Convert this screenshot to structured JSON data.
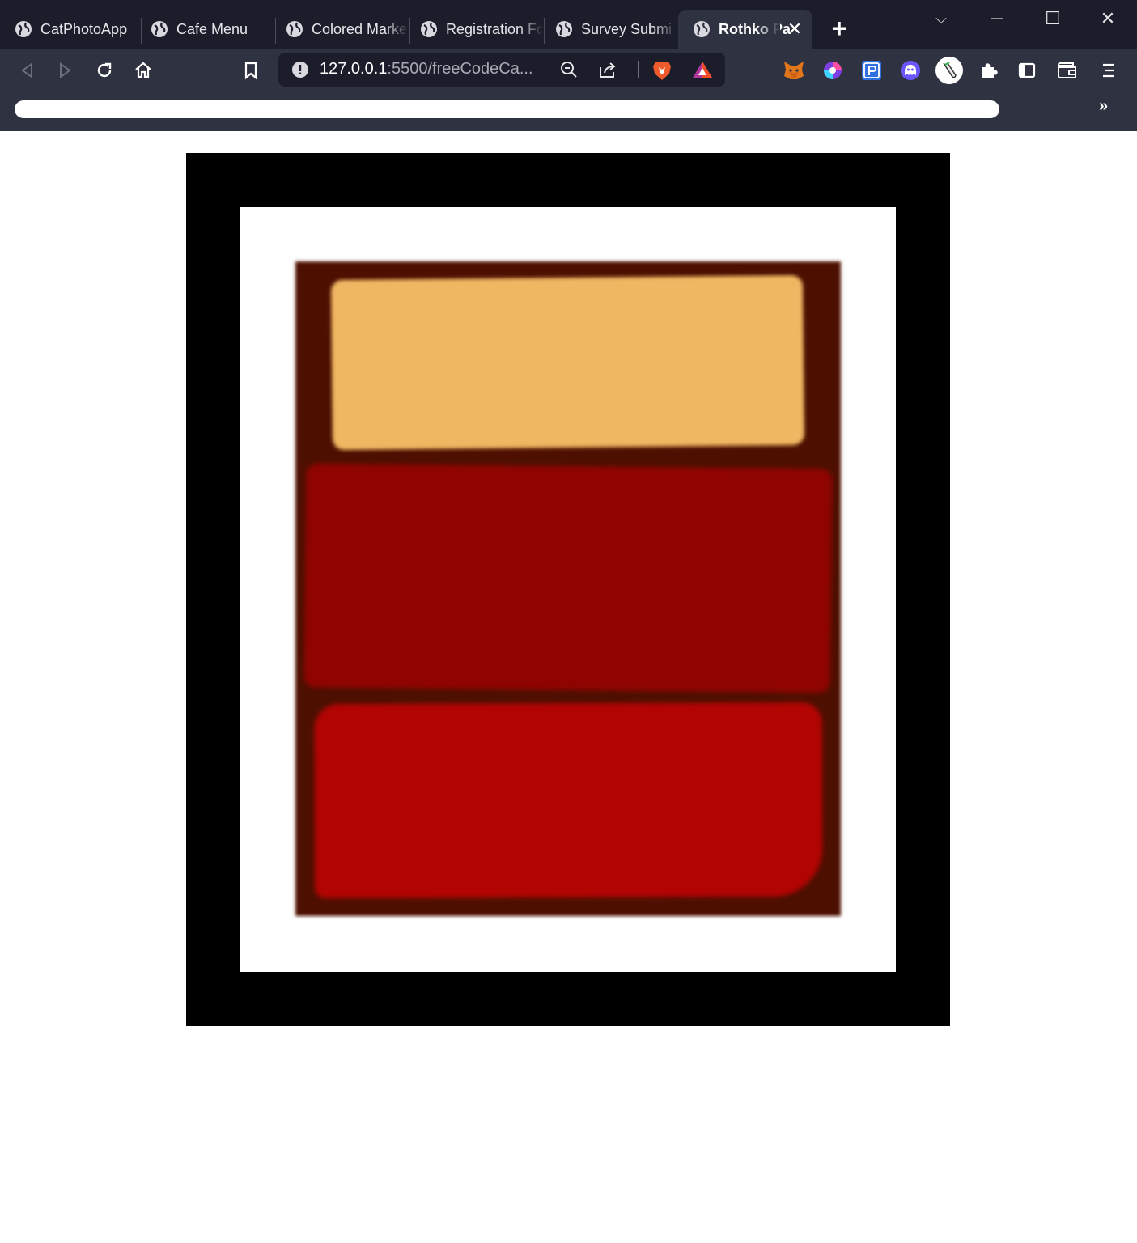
{
  "browser": {
    "tabs": [
      {
        "title": "CatPhotoApp",
        "active": false
      },
      {
        "title": "Cafe Menu",
        "active": false
      },
      {
        "title": "Colored Marke",
        "active": false
      },
      {
        "title": "Registration Fo",
        "active": false
      },
      {
        "title": "Survey Submi",
        "active": false
      },
      {
        "title": "Rothko Pa",
        "active": true
      }
    ],
    "close_tab_glyph": "✕",
    "new_tab_glyph": "+",
    "window_controls": {
      "tab_search": "⌵",
      "minimize": "—",
      "maximize": "☐",
      "close": "✕"
    },
    "omnibox": {
      "host": "127.0.0.1",
      "path": ":5500/freeCodeCa..."
    },
    "bookmarks_overflow": "»",
    "icons": [
      "back-icon",
      "forward-icon",
      "reload-icon",
      "home-icon",
      "bookmark-icon",
      "site-info-icon",
      "zoom-out-icon",
      "share-icon",
      "brave-shields-icon",
      "brave-rewards-icon",
      "metamask-icon",
      "extension-icon",
      "puzzle-icon",
      "sidebar-icon",
      "wallet-icon",
      "menu-icon"
    ]
  },
  "painting": {
    "colors": {
      "frame": "#000000",
      "canvas": "#ffffff",
      "background": "#4d0f00",
      "one": "#efb762",
      "two": "#8f0401",
      "three": "#b20403"
    }
  }
}
